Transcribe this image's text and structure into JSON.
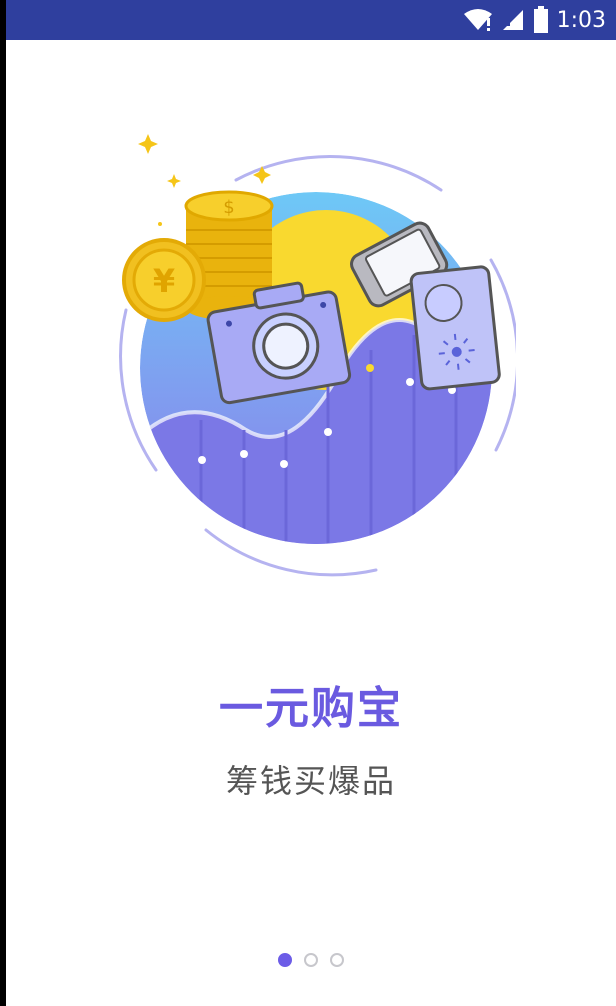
{
  "status_bar": {
    "time": "1:03",
    "icons": [
      "wifi-icon",
      "signal-icon",
      "battery-icon"
    ]
  },
  "onboarding": {
    "title": "一元购宝",
    "subtitle": "筹钱买爆品",
    "page_count": 3,
    "active_page": 1
  },
  "colors": {
    "status_bar": "#2f3f9e",
    "accent": "#6a5ae0",
    "coin": "#f5c518",
    "sun": "#f9d92f"
  }
}
